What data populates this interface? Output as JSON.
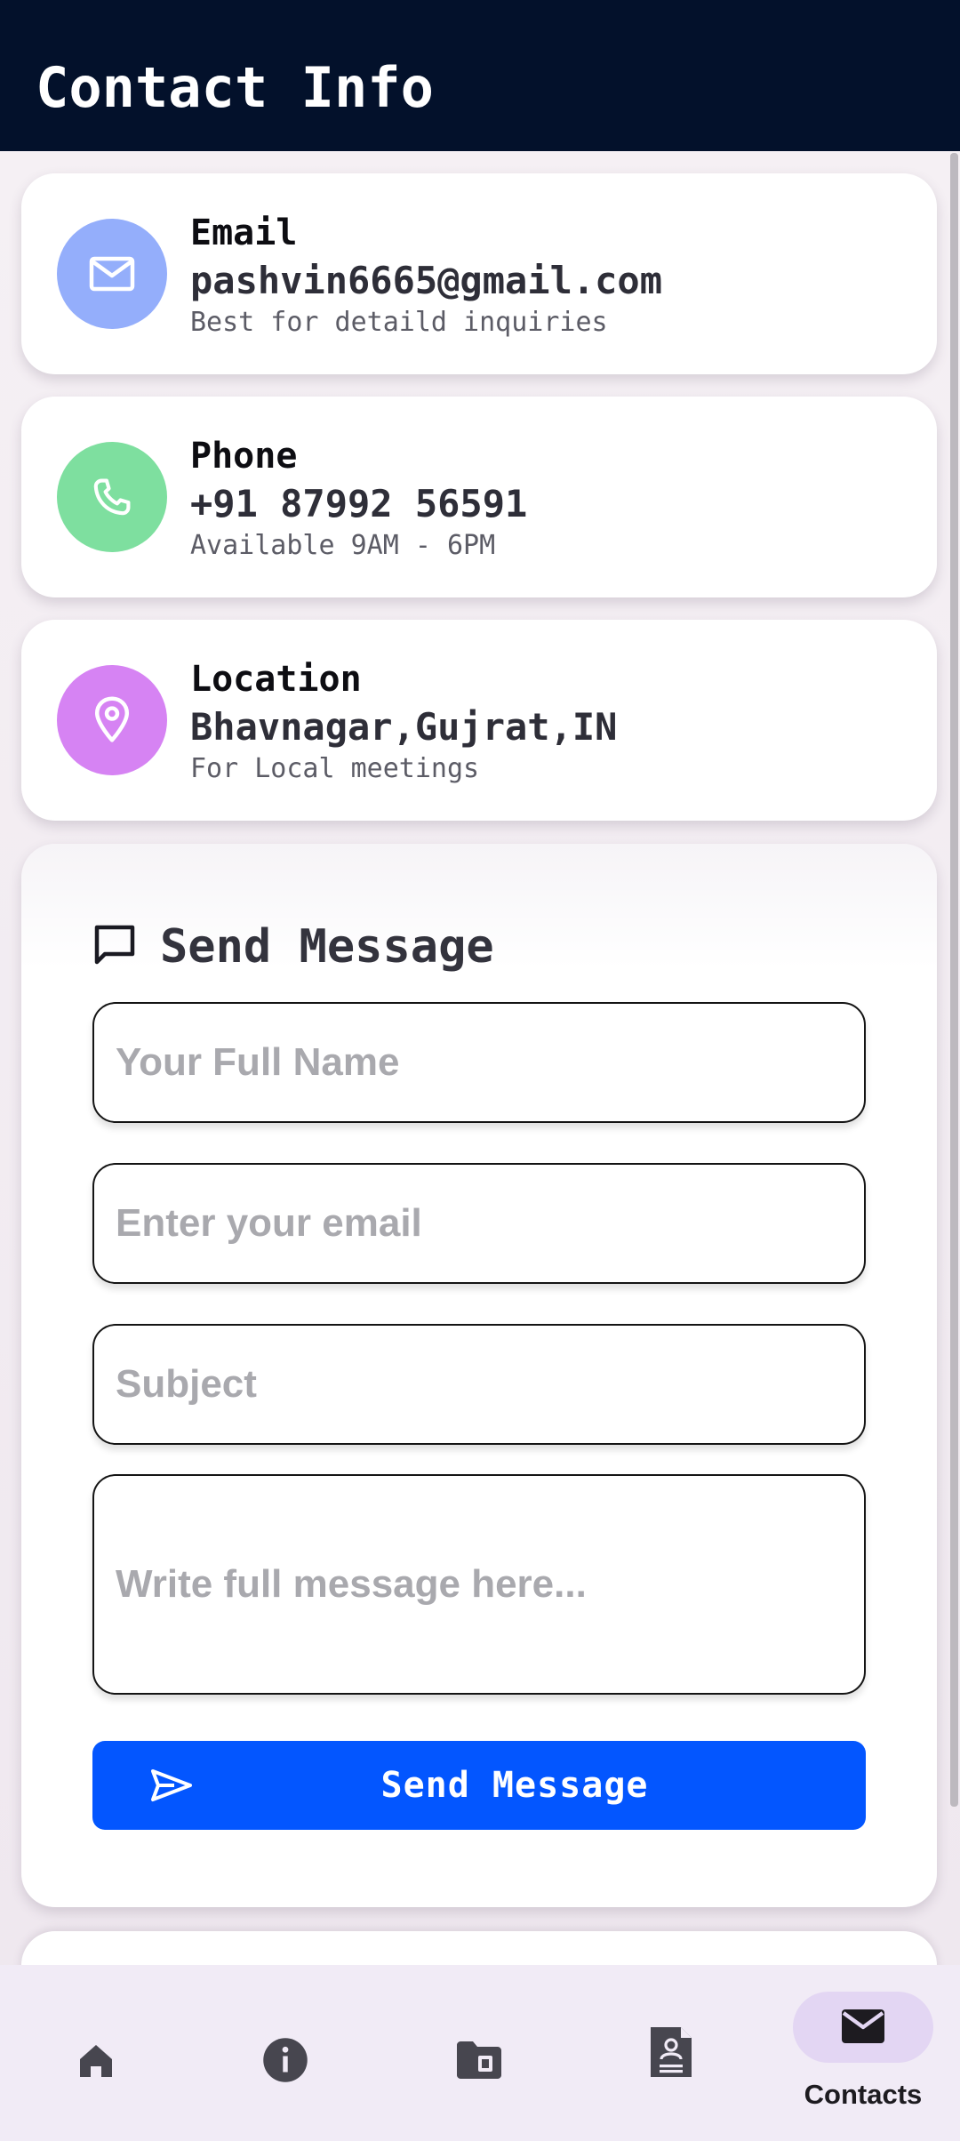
{
  "header": {
    "title": "Contact Info"
  },
  "info_cards": [
    {
      "title": "Email",
      "value": "pashvin6665@gmail.com",
      "note": "Best for detaild inquiries",
      "icon": "mail-icon",
      "color": "#94aefb"
    },
    {
      "title": "Phone",
      "value": "+91 87992 56591",
      "note": "Available 9AM - 6PM",
      "icon": "phone-icon",
      "color": "#7edf9f"
    },
    {
      "title": "Location",
      "value": "Bhavnagar,Gujrat,IN",
      "note": "For Local meetings",
      "icon": "location-pin-icon",
      "color": "#d683f3"
    }
  ],
  "form": {
    "title": "Send Message",
    "name_placeholder": "Your Full Name",
    "email_placeholder": "Enter your email",
    "subject_placeholder": "Subject",
    "message_placeholder": "Write full message here...",
    "submit_label": "Send Message",
    "accent": "#0356ff"
  },
  "bottom_nav": {
    "items": [
      {
        "icon": "home-icon"
      },
      {
        "icon": "info-icon"
      },
      {
        "icon": "folder-icon"
      },
      {
        "icon": "resume-icon"
      },
      {
        "icon": "mail-icon",
        "label": "Contacts",
        "active": true
      }
    ]
  }
}
